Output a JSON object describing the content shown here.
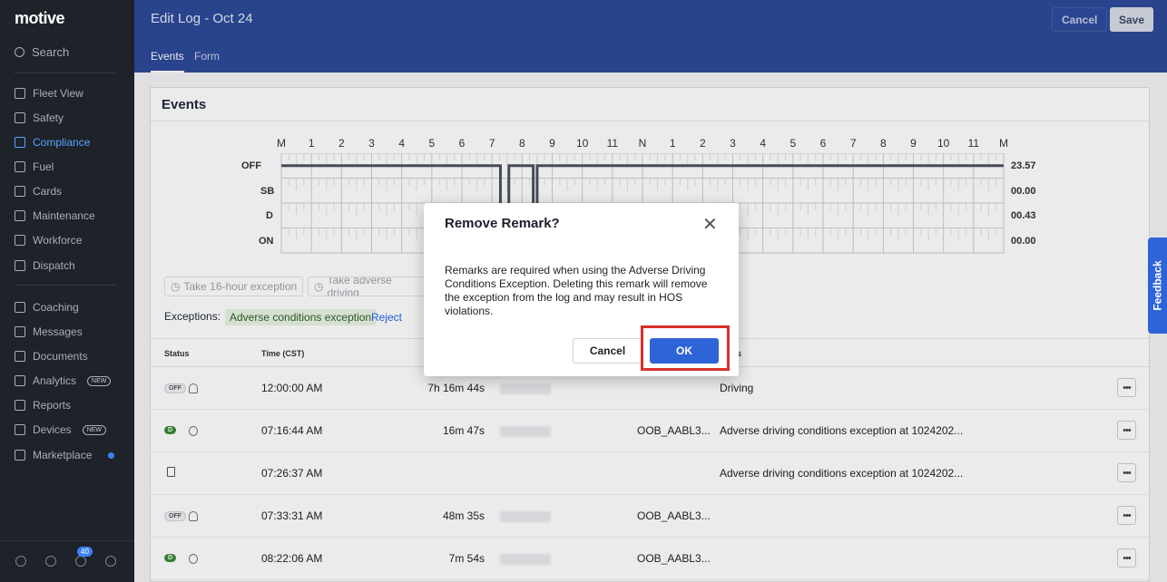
{
  "app": {
    "logo": "motive"
  },
  "sidebar": {
    "search_label": "Search",
    "items": [
      {
        "label": "Fleet View",
        "icon": "map-icon"
      },
      {
        "label": "Safety",
        "icon": "shield-icon"
      },
      {
        "label": "Compliance",
        "icon": "compliance-icon",
        "active": true
      },
      {
        "label": "Fuel",
        "icon": "fuel-icon"
      },
      {
        "label": "Cards",
        "icon": "card-icon"
      },
      {
        "label": "Maintenance",
        "icon": "wrench-icon"
      },
      {
        "label": "Workforce",
        "icon": "people-icon"
      },
      {
        "label": "Dispatch",
        "icon": "dispatch-icon"
      },
      {
        "label": "Coaching",
        "icon": "coaching-icon"
      },
      {
        "label": "Messages",
        "icon": "chat-icon"
      },
      {
        "label": "Documents",
        "icon": "document-icon"
      },
      {
        "label": "Analytics",
        "icon": "analytics-icon",
        "badge": "NEW"
      },
      {
        "label": "Reports",
        "icon": "reports-icon"
      },
      {
        "label": "Devices",
        "icon": "devices-icon",
        "badge": "NEW"
      },
      {
        "label": "Marketplace",
        "icon": "marketplace-icon",
        "dot": true
      }
    ],
    "notification_count": "40"
  },
  "header": {
    "title": "Edit Log - Oct 24",
    "cancel_label": "Cancel",
    "save_label": "Save",
    "tabs": [
      {
        "label": "Events",
        "active": true
      },
      {
        "label": "Form"
      }
    ]
  },
  "events": {
    "title": "Events",
    "hours": [
      "M",
      "1",
      "2",
      "3",
      "4",
      "5",
      "6",
      "7",
      "8",
      "9",
      "10",
      "11",
      "N",
      "1",
      "2",
      "3",
      "4",
      "5",
      "6",
      "7",
      "8",
      "9",
      "10",
      "11",
      "M"
    ],
    "rows": [
      {
        "label": "OFF",
        "total": "23.57"
      },
      {
        "label": "SB",
        "total": "00.00"
      },
      {
        "label": "D",
        "total": "00.43"
      },
      {
        "label": "ON",
        "total": "00.00"
      }
    ],
    "exception_buttons": [
      "Take 16-hour exception",
      "Take adverse driving"
    ],
    "exceptions_label": "Exceptions:",
    "exception_tag": "Adverse conditions exception",
    "reject_label": "Reject",
    "columns": {
      "status": "Status",
      "time": "Time (CST)",
      "notes": "s"
    },
    "table_rows": [
      {
        "status": "OFF",
        "time": "12:00:00 AM",
        "duration": "7h 16m 44s",
        "ref": "",
        "notes": "Driving"
      },
      {
        "status": "D",
        "time": "07:16:44 AM",
        "duration": "16m 47s",
        "ref": "OOB_AABL3...",
        "notes": "Adverse driving conditions exception at 1024202..."
      },
      {
        "status": "doc",
        "time": "07:26:37 AM",
        "duration": "",
        "ref": "",
        "notes": "Adverse driving conditions exception at 1024202..."
      },
      {
        "status": "OFF",
        "time": "07:33:31 AM",
        "duration": "48m 35s",
        "ref": "OOB_AABL3...",
        "notes": ""
      },
      {
        "status": "D",
        "time": "08:22:06 AM",
        "duration": "7m 54s",
        "ref": "OOB_AABL3...",
        "notes": ""
      }
    ]
  },
  "feedback_label": "Feedback",
  "modal": {
    "title": "Remove Remark?",
    "body": "Remarks are required when using the Adverse Driving Conditions Exception. Deleting this remark will remove the exception from the log and may result in HOS violations.",
    "cancel_label": "Cancel",
    "ok_label": "OK"
  }
}
